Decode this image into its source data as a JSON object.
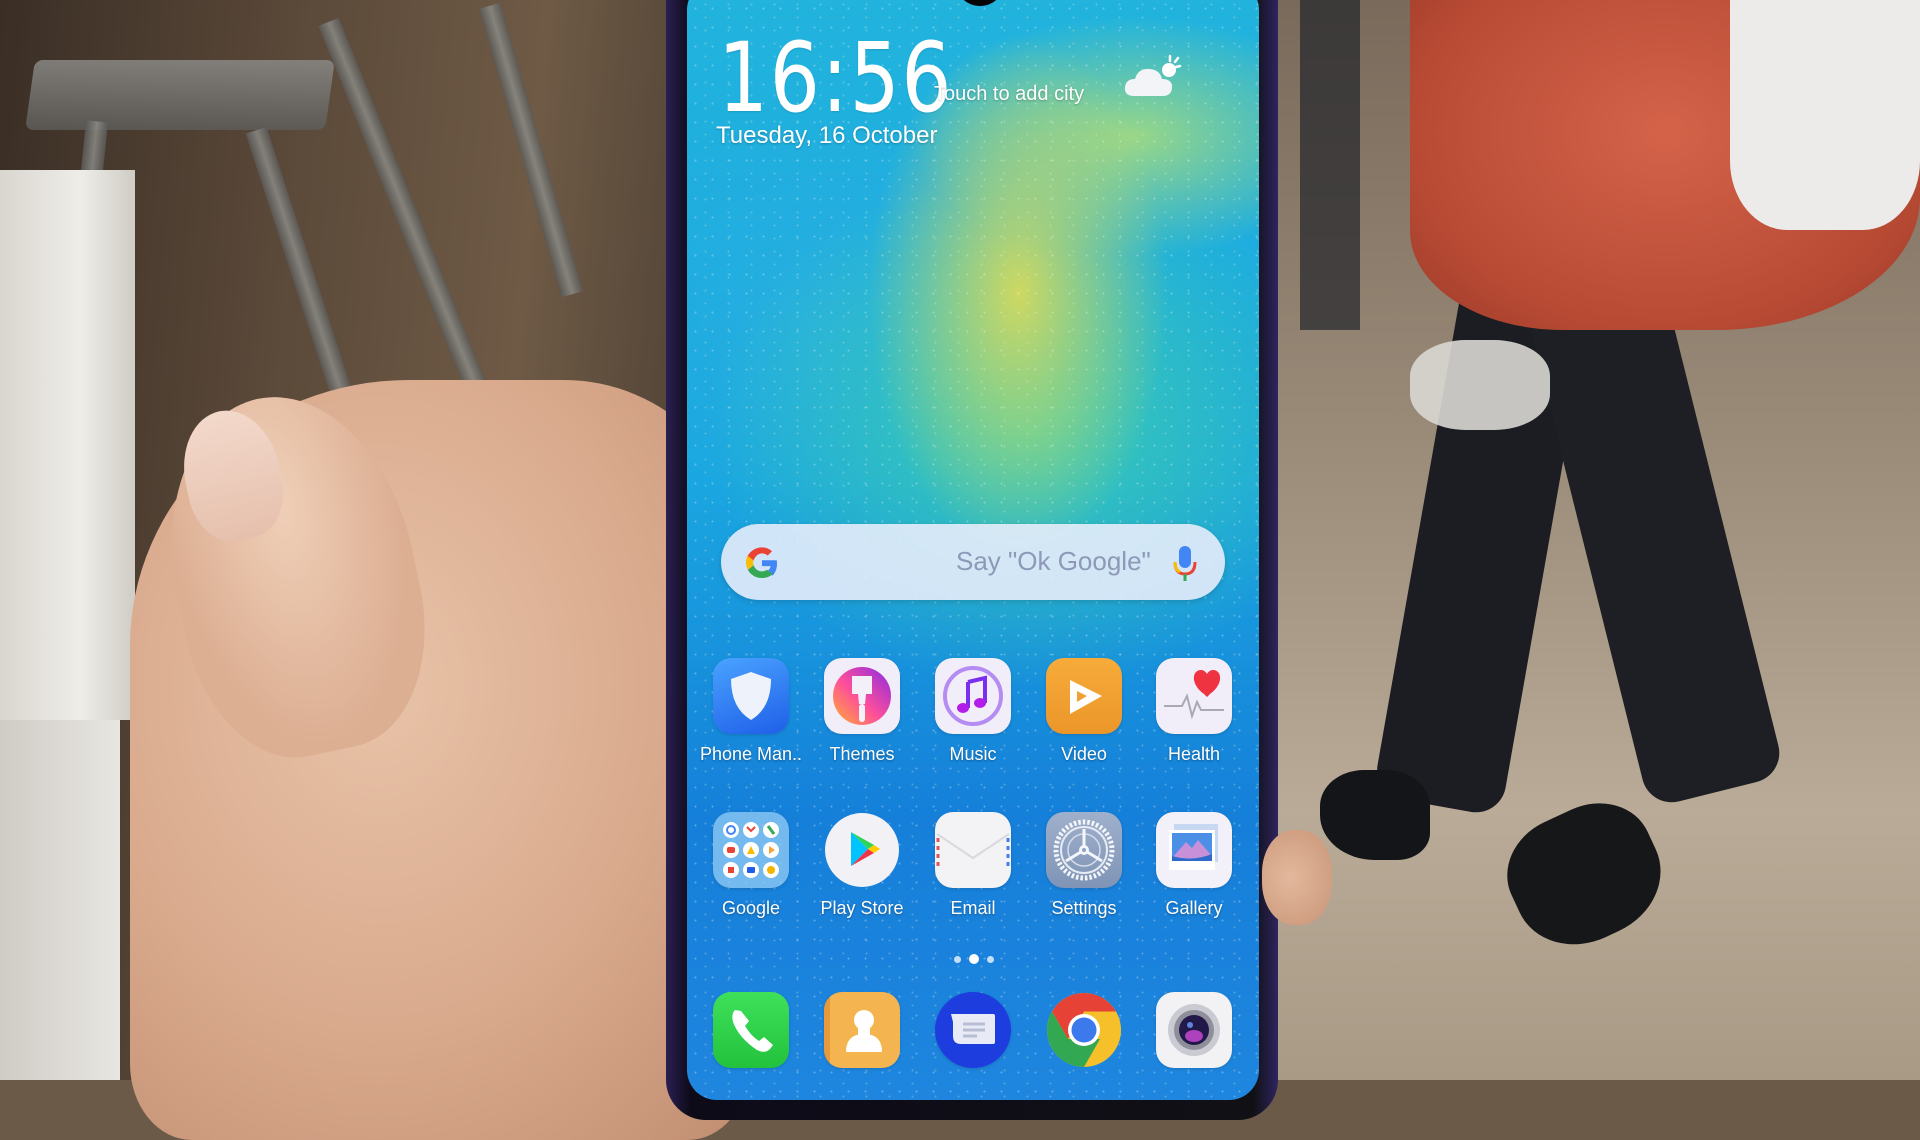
{
  "lockscreen": {
    "time": "16:56",
    "weather_hint": "Touch to add city",
    "weather_icon": "cloud-sun-icon",
    "date": "Tuesday, 16 October"
  },
  "search_widget": {
    "logo": "google-g-icon",
    "placeholder": "Say \"Ok Google\"",
    "mic_icon": "microphone-icon"
  },
  "home_grid": {
    "rows": [
      [
        {
          "label": "Phone Man..",
          "icon": "shield-icon",
          "color": "#2f7cf6"
        },
        {
          "label": "Themes",
          "icon": "paintbrush-icon",
          "color": "#f4f2fb"
        },
        {
          "label": "Music",
          "icon": "music-note-icon",
          "color": "#f4f2fb"
        },
        {
          "label": "Video",
          "icon": "play-icon",
          "color": "#f0a12e"
        },
        {
          "label": "Health",
          "icon": "heart-pulse-icon",
          "color": "#f4f2fb"
        }
      ],
      [
        {
          "label": "Google",
          "icon": "google-folder-icon",
          "color": "#6fb9ee"
        },
        {
          "label": "Play Store",
          "icon": "play-store-icon",
          "color": "#f4f2fb"
        },
        {
          "label": "Email",
          "icon": "envelope-icon",
          "color": "#f1f1f4"
        },
        {
          "label": "Settings",
          "icon": "gear-icon",
          "color": "#8fa3c2"
        },
        {
          "label": "Gallery",
          "icon": "photo-icon",
          "color": "#f4f2fb"
        }
      ]
    ]
  },
  "page_indicator": {
    "pages": 3,
    "current": 2
  },
  "dock": [
    {
      "name": "Phone",
      "icon": "phone-icon",
      "color": "#33d84a"
    },
    {
      "name": "Contacts",
      "icon": "contacts-icon",
      "color": "#f3b24d"
    },
    {
      "name": "Messages",
      "icon": "message-icon",
      "color": "#1e3fe0"
    },
    {
      "name": "Chrome",
      "icon": "chrome-icon",
      "color": "#ffffff"
    },
    {
      "name": "Camera",
      "icon": "camera-icon",
      "color": "#f2f2f4"
    }
  ]
}
